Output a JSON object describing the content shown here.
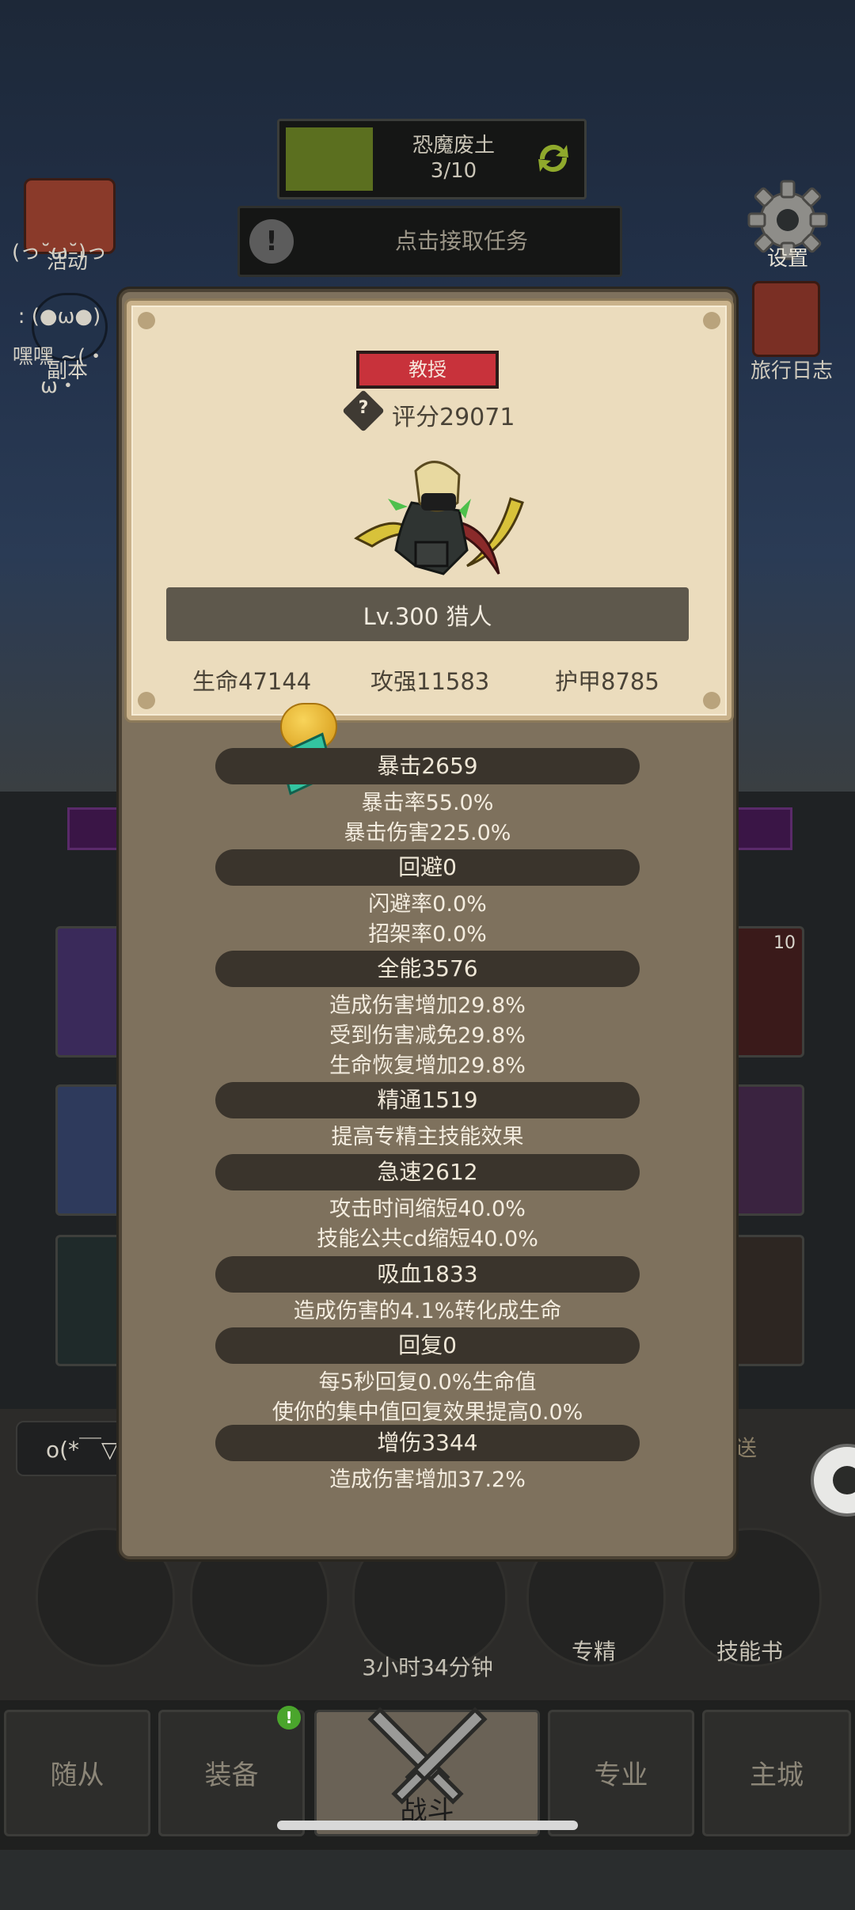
{
  "quest": {
    "name": "恐魔废土",
    "progress": "3/10"
  },
  "task": {
    "alert": "!",
    "text": "点击接取任务"
  },
  "left_side": {
    "event_label": "活动",
    "emote_1": "(っ˘ω˘)っ",
    "emote_2": ": (●ω●)",
    "dungeon_label": "副本",
    "emote_3": "嘿嘿 ~(・ω・"
  },
  "right_side": {
    "settings_label": "设置",
    "travel_log_label": "旅行日志"
  },
  "character": {
    "title": "教授",
    "help": "?",
    "score": "评分29071",
    "level_class": "Lv.300 猎人",
    "hp": "生命47144",
    "attack": "攻强11583",
    "armor": "护甲8785"
  },
  "stats": [
    {
      "title": "暴击2659",
      "lines": [
        "暴击率55.0%",
        "暴击伤害225.0%"
      ]
    },
    {
      "title": "回避0",
      "lines": [
        "闪避率0.0%",
        "招架率0.0%"
      ]
    },
    {
      "title": "全能3576",
      "lines": [
        "造成伤害增加29.8%",
        "受到伤害减免29.8%",
        "生命恢复增加29.8%"
      ]
    },
    {
      "title": "精通1519",
      "lines": [
        "提高专精主技能效果"
      ]
    },
    {
      "title": "急速2612",
      "lines": [
        "攻击时间缩短40.0%",
        "技能公共cd缩短40.0%"
      ]
    },
    {
      "title": "吸血1833",
      "lines": [
        "造成伤害的4.1%转化成生命"
      ]
    },
    {
      "title": "回复0",
      "lines": [
        "每5秒回复0.0%生命值",
        "使你的集中值回复效果提高0.0%"
      ]
    },
    {
      "title": "增伤3344",
      "lines": [
        "造成伤害增加37.2%"
      ]
    }
  ],
  "background": {
    "slot_badge": "10",
    "chat_placeholder": "o(*￣▽",
    "send_label": "发送",
    "specialize_label": "专精",
    "skillbook_label": "技能书",
    "timer": "3小时34分钟",
    "nav_dot": "!"
  },
  "nav": {
    "tabs": [
      "随从",
      "装备",
      "战斗",
      "专业",
      "主城"
    ],
    "active": "战斗"
  },
  "colors": {
    "modal_bg": "#7e715d",
    "card_bg": "#ebdcbd",
    "pill_bg": "#3a342c",
    "title_red": "#c8323b"
  }
}
